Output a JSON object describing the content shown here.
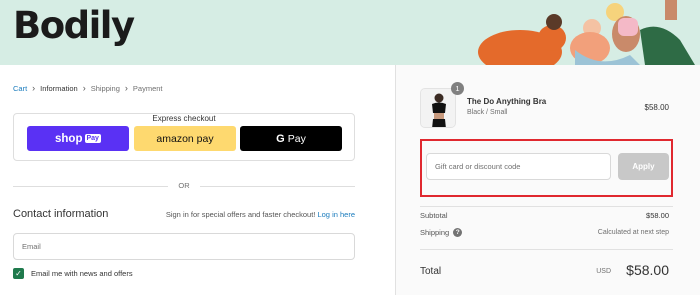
{
  "header": {
    "logo_text": "Bodily",
    "background_color": "#d6ede4"
  },
  "breadcrumb": {
    "items": [
      "Cart",
      "Information",
      "Shipping",
      "Payment"
    ],
    "current_index": 1
  },
  "express_checkout": {
    "title": "Express checkout",
    "shop_pay_label": "shop",
    "shop_pay_tag": "Pay",
    "amazon_pay_label": "amazon pay",
    "google_pay_label": "Pay",
    "google_pay_letter": "G"
  },
  "divider_or": "OR",
  "contact": {
    "title": "Contact information",
    "signin_text": "Sign in for special offers and faster checkout!",
    "login_link": "Log in here",
    "email_placeholder": "Email",
    "newsletter_label": "Email me with news and offers",
    "newsletter_checked": true
  },
  "order": {
    "product": {
      "name": "The Do Anything Bra",
      "variant": "Black / Small",
      "price": "$58.00",
      "quantity": "1"
    },
    "discount_placeholder": "Gift card or discount code",
    "apply_label": "Apply",
    "subtotal_label": "Subtotal",
    "subtotal_value": "$58.00",
    "shipping_label": "Shipping",
    "shipping_help": "?",
    "shipping_value": "Calculated at next step",
    "total_label": "Total",
    "total_currency": "USD",
    "total_value": "$58.00"
  },
  "colors": {
    "accent_link": "#197bbd",
    "shop_pay": "#5a31f4",
    "amazon_pay": "#fed96f",
    "google_pay": "#000000",
    "checkbox": "#1f7a4c",
    "highlight_box": "#e0282f"
  }
}
